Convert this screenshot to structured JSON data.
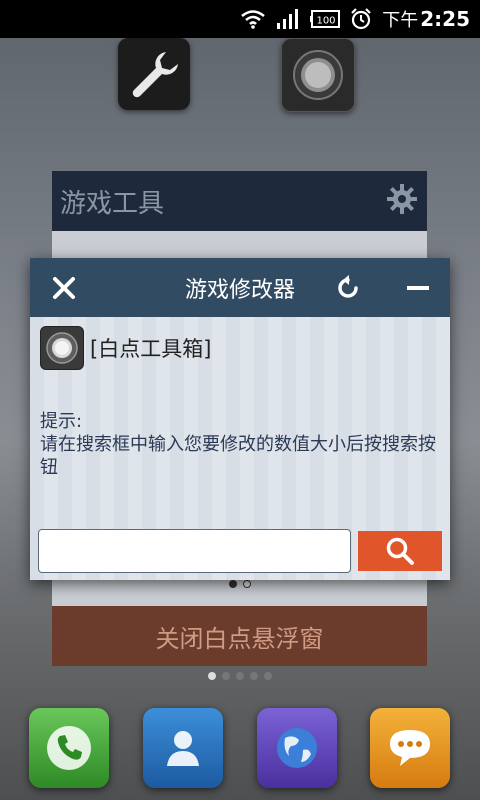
{
  "status_bar": {
    "battery": "100",
    "time_period": "下午",
    "time": "2:25"
  },
  "background": {
    "panel_title": "游戏工具",
    "close_float_button": "关闭白点悬浮窗",
    "dialog_page_dots": 2,
    "home_page_dots": 5
  },
  "dialog": {
    "title": "游戏修改器",
    "app_name": "[白点工具箱]",
    "hint_label": "提示:",
    "hint_text": "请在搜索框中输入您要修改的数值大小后按搜索按钮",
    "search_value": "",
    "search_placeholder": ""
  },
  "colors": {
    "dialog_header": "#314b63",
    "search_button": "#e0552a",
    "bg_button": "#6b3b2c"
  },
  "icons": {
    "close": "close-icon",
    "refresh": "refresh-icon",
    "minimize": "minimize-icon",
    "search": "search-icon",
    "settings": "gear-icon"
  }
}
